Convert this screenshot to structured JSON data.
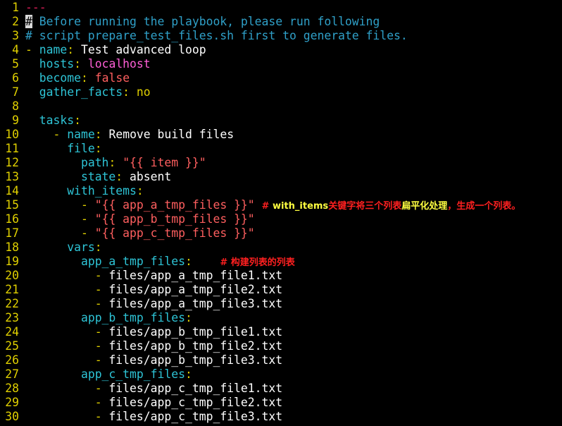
{
  "editor": {
    "lines": [
      {
        "n": "1",
        "segs": [
          {
            "t": "---",
            "c": "c-fold"
          }
        ]
      },
      {
        "n": "2",
        "segs": [
          {
            "t": "#",
            "c": "cursor"
          },
          {
            "t": " Before running the playbook, please run following",
            "c": "c-comment"
          }
        ]
      },
      {
        "n": "3",
        "segs": [
          {
            "t": "# script prepare_test_files.sh first to generate files.",
            "c": "c-comment"
          }
        ]
      },
      {
        "n": "4",
        "segs": [
          {
            "t": "-",
            "c": "c-dash"
          },
          {
            "t": " ",
            "c": "c-plain"
          },
          {
            "t": "name",
            "c": "c-key"
          },
          {
            "t": ":",
            "c": "c-colon"
          },
          {
            "t": " Test advanced loop",
            "c": "c-plain"
          }
        ]
      },
      {
        "n": "5",
        "segs": [
          {
            "t": "  ",
            "c": "c-plain"
          },
          {
            "t": "hosts",
            "c": "c-key"
          },
          {
            "t": ":",
            "c": "c-colon"
          },
          {
            "t": " ",
            "c": "c-plain"
          },
          {
            "t": "localhost",
            "c": "c-host"
          }
        ]
      },
      {
        "n": "6",
        "segs": [
          {
            "t": "  ",
            "c": "c-plain"
          },
          {
            "t": "become",
            "c": "c-key"
          },
          {
            "t": ":",
            "c": "c-colon"
          },
          {
            "t": " ",
            "c": "c-plain"
          },
          {
            "t": "false",
            "c": "c-bool"
          }
        ]
      },
      {
        "n": "7",
        "segs": [
          {
            "t": "  ",
            "c": "c-plain"
          },
          {
            "t": "gather_facts",
            "c": "c-key"
          },
          {
            "t": ":",
            "c": "c-colon"
          },
          {
            "t": " ",
            "c": "c-plain"
          },
          {
            "t": "no",
            "c": "c-no"
          }
        ]
      },
      {
        "n": "8",
        "segs": []
      },
      {
        "n": "9",
        "segs": [
          {
            "t": "  ",
            "c": "c-plain"
          },
          {
            "t": "tasks",
            "c": "c-key"
          },
          {
            "t": ":",
            "c": "c-colon"
          }
        ]
      },
      {
        "n": "10",
        "segs": [
          {
            "t": "    ",
            "c": "c-plain"
          },
          {
            "t": "-",
            "c": "c-dash"
          },
          {
            "t": " ",
            "c": "c-plain"
          },
          {
            "t": "name",
            "c": "c-key"
          },
          {
            "t": ":",
            "c": "c-colon"
          },
          {
            "t": " Remove build files",
            "c": "c-plain"
          }
        ]
      },
      {
        "n": "11",
        "segs": [
          {
            "t": "      ",
            "c": "c-plain"
          },
          {
            "t": "file",
            "c": "c-key"
          },
          {
            "t": ":",
            "c": "c-colon"
          }
        ]
      },
      {
        "n": "12",
        "segs": [
          {
            "t": "        ",
            "c": "c-plain"
          },
          {
            "t": "path",
            "c": "c-key"
          },
          {
            "t": ":",
            "c": "c-colon"
          },
          {
            "t": " ",
            "c": "c-plain"
          },
          {
            "t": "\"{{ item }}\"",
            "c": "c-str"
          }
        ]
      },
      {
        "n": "13",
        "segs": [
          {
            "t": "        ",
            "c": "c-plain"
          },
          {
            "t": "state",
            "c": "c-key"
          },
          {
            "t": ":",
            "c": "c-colon"
          },
          {
            "t": " absent",
            "c": "c-plain"
          }
        ]
      },
      {
        "n": "14",
        "segs": [
          {
            "t": "      ",
            "c": "c-plain"
          },
          {
            "t": "with_items",
            "c": "c-key"
          },
          {
            "t": ":",
            "c": "c-colon"
          }
        ]
      },
      {
        "n": "15",
        "segs": [
          {
            "t": "        ",
            "c": "c-plain"
          },
          {
            "t": "-",
            "c": "c-list-dash"
          },
          {
            "t": " ",
            "c": "c-plain"
          },
          {
            "t": "\"{{ app_a_tmp_files }}\"",
            "c": "c-str"
          },
          {
            "t": " ",
            "c": "c-plain"
          }
        ]
      },
      {
        "n": "16",
        "segs": [
          {
            "t": "        ",
            "c": "c-plain"
          },
          {
            "t": "-",
            "c": "c-list-dash"
          },
          {
            "t": " ",
            "c": "c-plain"
          },
          {
            "t": "\"{{ app_b_tmp_files }}\"",
            "c": "c-str"
          }
        ]
      },
      {
        "n": "17",
        "segs": [
          {
            "t": "        ",
            "c": "c-plain"
          },
          {
            "t": "-",
            "c": "c-list-dash"
          },
          {
            "t": " ",
            "c": "c-plain"
          },
          {
            "t": "\"{{ app_c_tmp_files }}\"",
            "c": "c-str"
          }
        ]
      },
      {
        "n": "18",
        "segs": [
          {
            "t": "      ",
            "c": "c-plain"
          },
          {
            "t": "vars",
            "c": "c-key"
          },
          {
            "t": ":",
            "c": "c-colon"
          }
        ]
      },
      {
        "n": "19",
        "segs": [
          {
            "t": "        ",
            "c": "c-plain"
          },
          {
            "t": "app_a_tmp_files",
            "c": "c-key"
          },
          {
            "t": ":",
            "c": "c-colon"
          },
          {
            "t": "    ",
            "c": "c-plain"
          }
        ]
      },
      {
        "n": "20",
        "segs": [
          {
            "t": "          ",
            "c": "c-plain"
          },
          {
            "t": "-",
            "c": "c-list-dash"
          },
          {
            "t": " files/app_a_tmp_file1.txt",
            "c": "c-plain"
          }
        ]
      },
      {
        "n": "21",
        "segs": [
          {
            "t": "          ",
            "c": "c-plain"
          },
          {
            "t": "-",
            "c": "c-list-dash"
          },
          {
            "t": " files/app_a_tmp_file2.txt",
            "c": "c-plain"
          }
        ]
      },
      {
        "n": "22",
        "segs": [
          {
            "t": "          ",
            "c": "c-plain"
          },
          {
            "t": "-",
            "c": "c-list-dash"
          },
          {
            "t": " files/app_a_tmp_file3.txt",
            "c": "c-plain"
          }
        ]
      },
      {
        "n": "23",
        "segs": [
          {
            "t": "        ",
            "c": "c-plain"
          },
          {
            "t": "app_b_tmp_files",
            "c": "c-key"
          },
          {
            "t": ":",
            "c": "c-colon"
          }
        ]
      },
      {
        "n": "24",
        "segs": [
          {
            "t": "          ",
            "c": "c-plain"
          },
          {
            "t": "-",
            "c": "c-list-dash"
          },
          {
            "t": " files/app_b_tmp_file1.txt",
            "c": "c-plain"
          }
        ]
      },
      {
        "n": "25",
        "segs": [
          {
            "t": "          ",
            "c": "c-plain"
          },
          {
            "t": "-",
            "c": "c-list-dash"
          },
          {
            "t": " files/app_b_tmp_file2.txt",
            "c": "c-plain"
          }
        ]
      },
      {
        "n": "26",
        "segs": [
          {
            "t": "          ",
            "c": "c-plain"
          },
          {
            "t": "-",
            "c": "c-list-dash"
          },
          {
            "t": " files/app_b_tmp_file3.txt",
            "c": "c-plain"
          }
        ]
      },
      {
        "n": "27",
        "segs": [
          {
            "t": "        ",
            "c": "c-plain"
          },
          {
            "t": "app_c_tmp_files",
            "c": "c-key"
          },
          {
            "t": ":",
            "c": "c-colon"
          }
        ]
      },
      {
        "n": "28",
        "segs": [
          {
            "t": "          ",
            "c": "c-plain"
          },
          {
            "t": "-",
            "c": "c-list-dash"
          },
          {
            "t": " files/app_c_tmp_file1.txt",
            "c": "c-plain"
          }
        ]
      },
      {
        "n": "29",
        "segs": [
          {
            "t": "          ",
            "c": "c-plain"
          },
          {
            "t": "-",
            "c": "c-list-dash"
          },
          {
            "t": " files/app_c_tmp_file2.txt",
            "c": "c-plain"
          }
        ]
      },
      {
        "n": "30",
        "segs": [
          {
            "t": "          ",
            "c": "c-plain"
          },
          {
            "t": "-",
            "c": "c-list-dash"
          },
          {
            "t": " files/app_c_tmp_file3.txt",
            "c": "c-plain"
          }
        ]
      }
    ]
  },
  "annotations": {
    "line15": {
      "parts": [
        {
          "t": "# ",
          "c": "a-red"
        },
        {
          "t": "with_items",
          "c": "a-yellow"
        },
        {
          "t": "关键字将三个列表",
          "c": "a-red"
        },
        {
          "t": "扁平化处理",
          "c": "a-yellow"
        },
        {
          "t": "，生成一个列表。",
          "c": "a-red"
        }
      ]
    },
    "line19": {
      "parts": [
        {
          "t": "# 构建列表的列表",
          "c": "a-red"
        }
      ]
    }
  },
  "colors": {
    "background": "#000000",
    "line_number": "#e0d000",
    "comment": "#2fa0c8",
    "key": "#2ec4d6",
    "string": "#ff5f5f",
    "host": "#ff5fd7",
    "annotation_red": "#ff2020",
    "annotation_yellow": "#ffff40"
  }
}
